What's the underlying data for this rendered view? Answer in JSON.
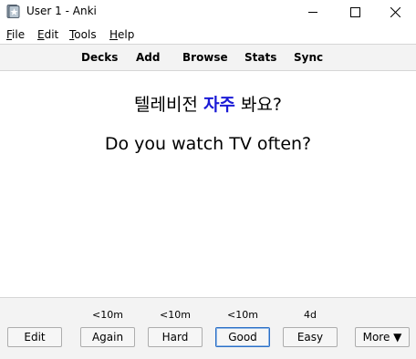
{
  "window": {
    "title": "User 1 - Anki",
    "app_icon": "anki-star-icon",
    "minimize_icon": "minimize-icon",
    "maximize_icon": "maximize-icon",
    "close_icon": "close-icon"
  },
  "menu": {
    "file": {
      "mnemonic": "F",
      "rest": "ile"
    },
    "edit": {
      "mnemonic": "E",
      "rest": "dit"
    },
    "tools": {
      "mnemonic": "T",
      "rest": "ools"
    },
    "help": {
      "mnemonic": "H",
      "rest": "elp"
    }
  },
  "toolbar": {
    "decks": "Decks",
    "add": "Add",
    "browse": "Browse",
    "stats": "Stats",
    "sync": "Sync"
  },
  "card": {
    "front_before": "텔레비전 ",
    "front_highlight": "자주",
    "front_after": " 봐요?",
    "highlight_color": "#1a1ad6",
    "back": "Do you watch TV often?"
  },
  "review": {
    "edit_label": "Edit",
    "more_label": "More ▼",
    "answers": [
      {
        "label": "Again",
        "interval": "<10m"
      },
      {
        "label": "Hard",
        "interval": "<10m"
      },
      {
        "label": "Good",
        "interval": "<10m"
      },
      {
        "label": "Easy",
        "interval": "4d"
      }
    ]
  }
}
